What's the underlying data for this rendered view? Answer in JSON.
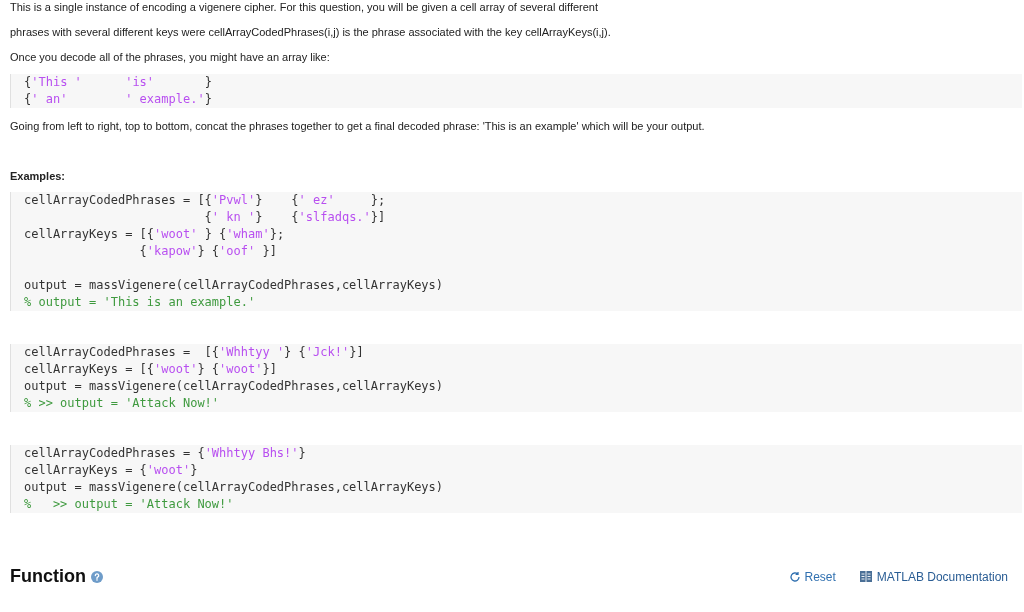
{
  "intro_paragraphs": [
    "This is a single instance of encoding a vigenere cipher. For this question, you will be given a cell array of several different",
    "phrases with several different keys were  cellArrayCodedPhrases(i,j) is the phrase associated with the key cellArrayKeys(i,j).",
    "Once you decode all of the phrases, you might have an array like:"
  ],
  "intro_code": [
    {
      "tokens": [
        {
          "kind": "plain",
          "text": "{"
        },
        {
          "kind": "string",
          "text": "'This '      "
        },
        {
          "kind": "string",
          "text": "'is'"
        },
        {
          "kind": "plain",
          "text": "       }"
        }
      ]
    },
    {
      "tokens": [
        {
          "kind": "plain",
          "text": "{"
        },
        {
          "kind": "string",
          "text": "' an'        "
        },
        {
          "kind": "string",
          "text": "' example.'"
        },
        {
          "kind": "plain",
          "text": "}"
        }
      ]
    }
  ],
  "after_paragraph": "Going from left to right, top to bottom, concat the phrases together to get a final decoded phrase: 'This is an example' which will be your output.",
  "examples_heading": "Examples:",
  "examples": [
    {
      "line_groups": [
        [
          {
            "tokens": [
              {
                "kind": "plain",
                "text": "cellArrayCodedPhrases = [{"
              },
              {
                "kind": "string",
                "text": "'Pvwl'"
              },
              {
                "kind": "plain",
                "text": "}    {"
              },
              {
                "kind": "string",
                "text": "' ez'"
              },
              {
                "kind": "plain",
                "text": "     };"
              }
            ]
          },
          {
            "tokens": [
              {
                "kind": "plain",
                "text": "                         {"
              },
              {
                "kind": "string",
                "text": "' kn '"
              },
              {
                "kind": "plain",
                "text": "}    {"
              },
              {
                "kind": "string",
                "text": "'slfadqs.'"
              },
              {
                "kind": "plain",
                "text": "}]"
              }
            ]
          },
          {
            "tokens": [
              {
                "kind": "plain",
                "text": "cellArrayKeys = [{"
              },
              {
                "kind": "string",
                "text": "'woot'"
              },
              {
                "kind": "plain",
                "text": " } {"
              },
              {
                "kind": "string",
                "text": "'wham'"
              },
              {
                "kind": "plain",
                "text": "};"
              }
            ]
          },
          {
            "tokens": [
              {
                "kind": "plain",
                "text": "                {"
              },
              {
                "kind": "string",
                "text": "'kapow'"
              },
              {
                "kind": "plain",
                "text": "} {"
              },
              {
                "kind": "string",
                "text": "'oof'"
              },
              {
                "kind": "plain",
                "text": " }]"
              }
            ]
          }
        ],
        [
          {
            "tokens": [
              {
                "kind": "plain",
                "text": "output = massVigenere(cellArrayCodedPhrases,cellArrayKeys)"
              }
            ]
          },
          {
            "tokens": [
              {
                "kind": "comment",
                "text": "% output = 'This is an example.'"
              }
            ]
          }
        ]
      ]
    },
    {
      "line_groups": [
        [
          {
            "tokens": [
              {
                "kind": "plain",
                "text": "cellArrayCodedPhrases =  [{"
              },
              {
                "kind": "string",
                "text": "'Whhtyy '"
              },
              {
                "kind": "plain",
                "text": "} {"
              },
              {
                "kind": "string",
                "text": "'Jck!'"
              },
              {
                "kind": "plain",
                "text": "}]"
              }
            ]
          },
          {
            "tokens": [
              {
                "kind": "plain",
                "text": "cellArrayKeys = [{"
              },
              {
                "kind": "string",
                "text": "'woot'"
              },
              {
                "kind": "plain",
                "text": "} {"
              },
              {
                "kind": "string",
                "text": "'woot'"
              },
              {
                "kind": "plain",
                "text": "}]"
              }
            ]
          },
          {
            "tokens": [
              {
                "kind": "plain",
                "text": "output = massVigenere(cellArrayCodedPhrases,cellArrayKeys)"
              }
            ]
          },
          {
            "tokens": [
              {
                "kind": "comment",
                "text": "% >> output = 'Attack Now!'"
              }
            ]
          }
        ]
      ]
    },
    {
      "line_groups": [
        [
          {
            "tokens": [
              {
                "kind": "plain",
                "text": "cellArrayCodedPhrases = {"
              },
              {
                "kind": "string",
                "text": "'Whhtyy Bhs!'"
              },
              {
                "kind": "plain",
                "text": "}"
              }
            ]
          },
          {
            "tokens": [
              {
                "kind": "plain",
                "text": "cellArrayKeys = {"
              },
              {
                "kind": "string",
                "text": "'woot'"
              },
              {
                "kind": "plain",
                "text": "}"
              }
            ]
          },
          {
            "tokens": [
              {
                "kind": "plain",
                "text": "output = massVigenere(cellArrayCodedPhrases,cellArrayKeys)"
              }
            ]
          },
          {
            "tokens": [
              {
                "kind": "comment",
                "text": "%   >> output = 'Attack Now!'"
              }
            ]
          }
        ]
      ]
    }
  ],
  "function_section": {
    "title": "Function",
    "reset_link": "Reset",
    "docs_link": "MATLAB Documentation"
  }
}
